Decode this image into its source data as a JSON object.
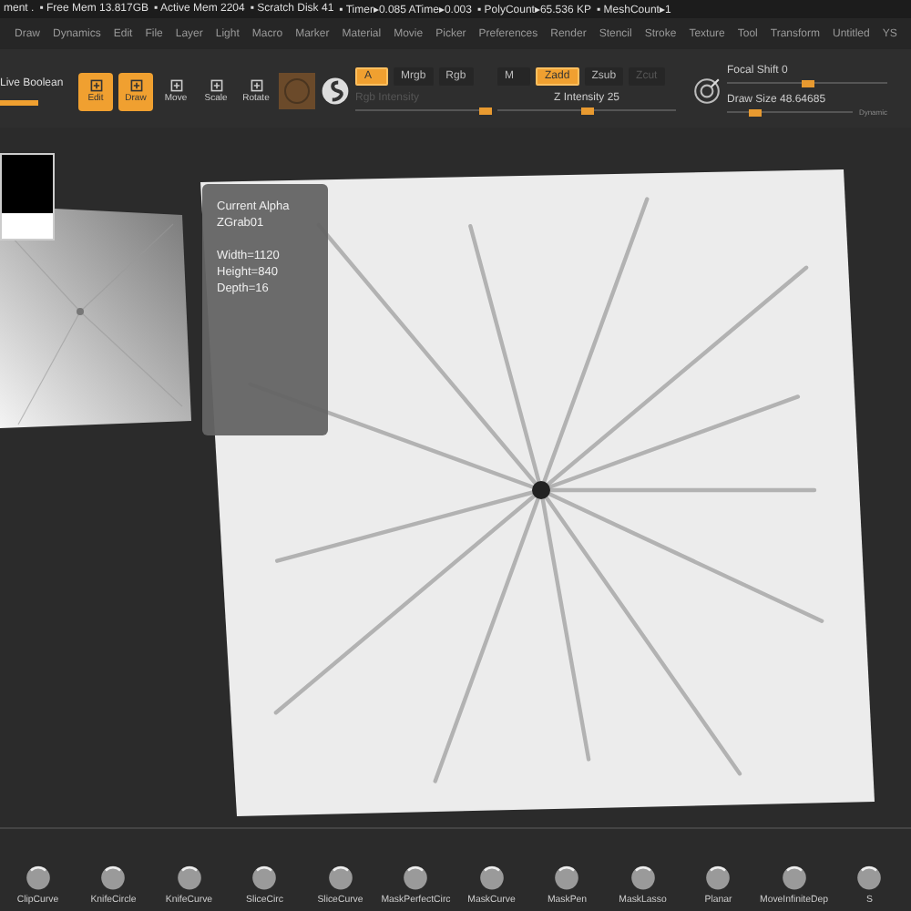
{
  "status_bar": [
    "ment .",
    "▪ Free Mem 13.817GB",
    "▪ Active Mem 2204",
    "▪ Scratch Disk 41",
    "▪ Timer▸0.085 ATime▸0.003",
    "▪ PolyCount▸65.536 KP",
    "▪ MeshCount▸1"
  ],
  "menu": [
    "Draw",
    "Dynamics",
    "Edit",
    "File",
    "Layer",
    "Light",
    "Macro",
    "Marker",
    "Material",
    "Movie",
    "Picker",
    "Preferences",
    "Render",
    "Stencil",
    "Stroke",
    "Texture",
    "Tool",
    "Transform",
    "Untitled",
    "YS"
  ],
  "toolbar": {
    "live_boolean": "Live Boolean",
    "modes": [
      {
        "label": "Edit",
        "selected": true
      },
      {
        "label": "Draw",
        "selected": true
      },
      {
        "label": "Move",
        "selected": false
      },
      {
        "label": "Scale",
        "selected": false
      },
      {
        "label": "Rotate",
        "selected": false
      }
    ],
    "color_modes": [
      {
        "label": "A",
        "selected": true
      },
      {
        "label": "Mrgb",
        "selected": false
      },
      {
        "label": "Rgb",
        "selected": false
      }
    ],
    "rgb_intensity": {
      "label": "Rgb Intensity",
      "disabled": true,
      "level": 0.95
    },
    "z_modes": [
      {
        "label": "M",
        "selected": false,
        "disabled": false
      },
      {
        "label": "Zadd",
        "selected": true,
        "disabled": false
      },
      {
        "label": "Zsub",
        "selected": false,
        "disabled": false
      },
      {
        "label": "Zcut",
        "selected": false,
        "disabled": true
      }
    ],
    "z_intensity": {
      "label": "Z Intensity 25",
      "level": 0.5
    },
    "focal_shift": {
      "label": "Focal Shift 0",
      "level": 0.5
    },
    "draw_size": {
      "label": "Draw Size 48.64685",
      "level": 0.22
    },
    "dynamic": "Dynamic"
  },
  "tooltip": {
    "title_lines": [
      "Current Alpha",
      "ZGrab01"
    ],
    "info_lines": [
      "Width=1120",
      "Height=840",
      "Depth=16"
    ]
  },
  "brushes": [
    "ClipCurve",
    "KnifeCircle",
    "KnifeCurve",
    "SliceCirc",
    "SliceCurve",
    "MaskPerfectCirc",
    "MaskCurve",
    "MaskPen",
    "MaskLasso",
    "Planar",
    "MoveInfiniteDep",
    "S"
  ]
}
